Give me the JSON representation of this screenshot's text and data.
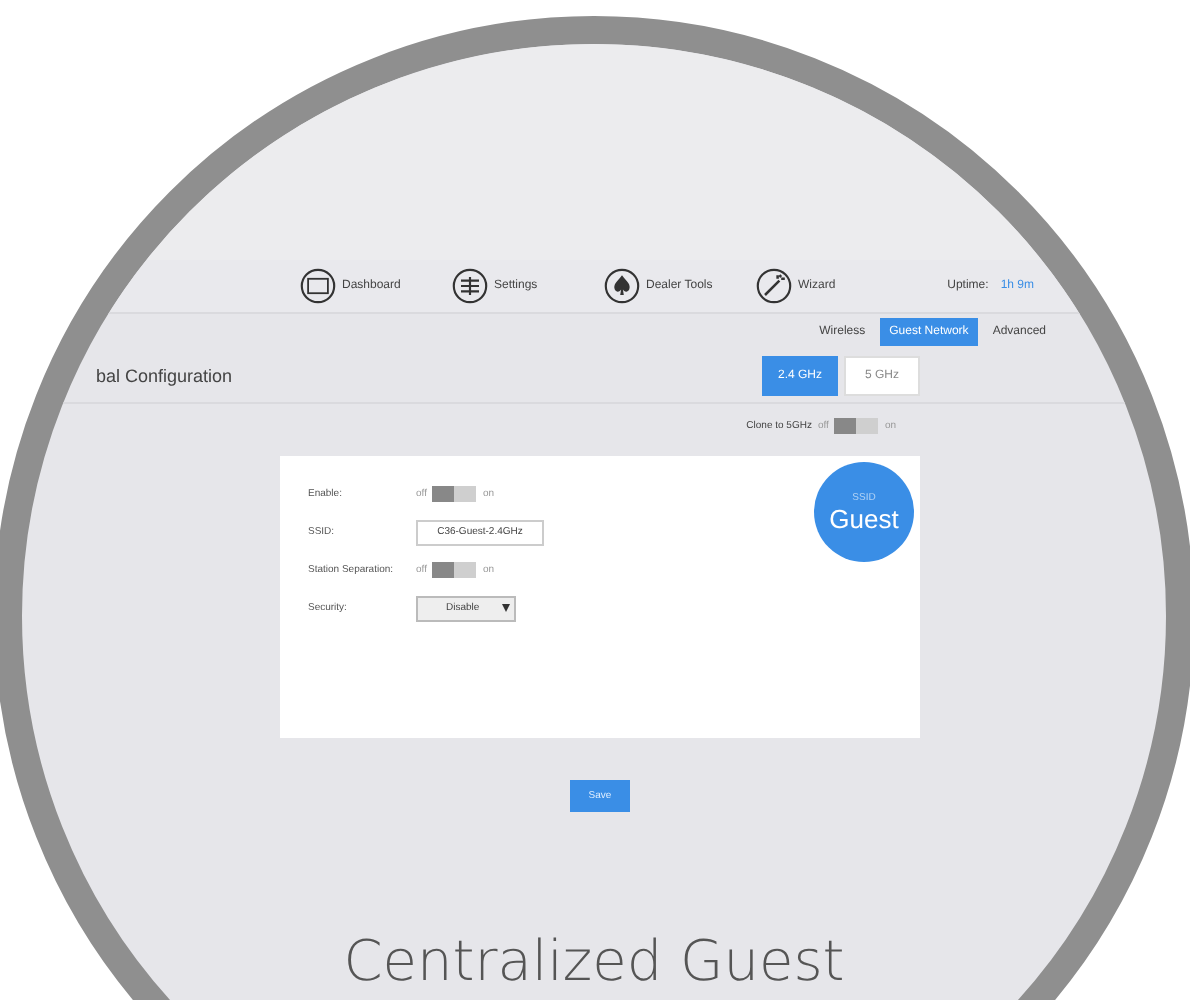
{
  "nav": [
    {
      "label": "Dashboard"
    },
    {
      "label": "Settings"
    },
    {
      "label": "Dealer Tools"
    },
    {
      "label": "Wizard"
    }
  ],
  "uptime": {
    "label": "Uptime:",
    "value": "1h 9m"
  },
  "subtabs": [
    {
      "label": "Wireless",
      "selected": false
    },
    {
      "label": "Guest Network",
      "selected": true
    },
    {
      "label": "Advanced",
      "selected": false
    }
  ],
  "section_title": "bal Configuration",
  "bands": [
    {
      "label": "2.4 GHz",
      "selected": true
    },
    {
      "label": "5 GHz",
      "selected": false
    }
  ],
  "clone": {
    "label": "Clone to 5GHz",
    "off_label": "off",
    "on_label": "on",
    "on": false
  },
  "form": [
    {
      "kind": "toggle",
      "label": "Enable:",
      "off_label": "off",
      "on_label": "on",
      "on": false
    },
    {
      "kind": "text",
      "label": "SSID:",
      "value": "C36-Guest-2.4GHz"
    },
    {
      "kind": "toggle",
      "label": "Station Separation:",
      "off_label": "off",
      "on_label": "on",
      "on": false
    },
    {
      "kind": "select",
      "label": "Security:",
      "value": "Disable"
    }
  ],
  "badge": {
    "caption": "SSID",
    "title": "Guest"
  },
  "save": "Save",
  "caption": "Centralized Guest"
}
